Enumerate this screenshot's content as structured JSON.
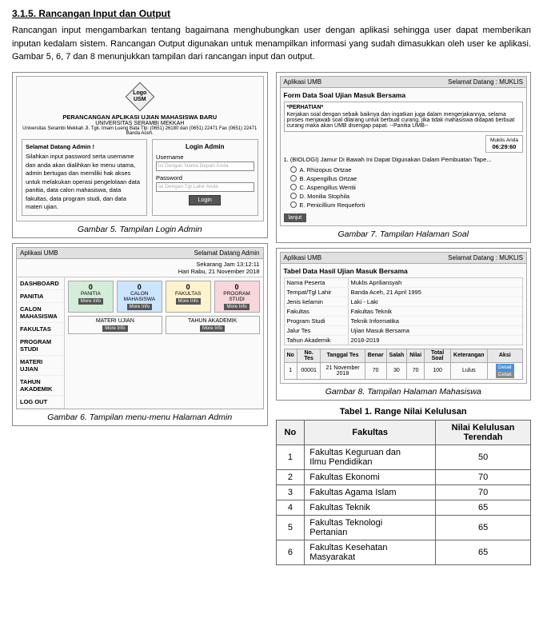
{
  "section": {
    "title": "3.1.5. Rancangan Input dan Output",
    "intro": "Rancangan input mengambarkan tentang bagaimana menghubungkan user dengan aplikasi sehingga user dapat memberikan inputan kedalam sistem. Rancangan Output digunakan untuk menampilkan informasi yang sudah dimasukkan oleh user ke aplikasi. Gambar 5, 6, 7 dan 8 menunjukkan tampilan dari rancangan input dan output."
  },
  "fig5": {
    "caption": "Gambar 5. Tampilan Login Admin",
    "logo": {
      "line1": "Logo",
      "line2": "USM"
    },
    "app_title": "PERANCANGAN APLIKASI UJIAN MAHASISWA BARU",
    "app_subtitle": "UNIVERSITAS SERAMBI MEKKAH",
    "app_address": "Universitas Serambi Mekkah Jl. Tgk. Imam Lueng Bata Tlp: (0651) 26180 dan (0651) 22471 Fax (0651) 22471 Banda Aceh.",
    "left_panel_title": "Selamat Datang Admin !",
    "left_panel_text": "Silahkan input password serta username dan anda akan dialihkan ke menu utama, admin bertugas dan memiliki hak akses untuk melakukan operasi pengelolaan data panitia, data calon mahasiswa, data fakultas, data program studi, dan data materi ujian.",
    "right_panel_title": "Login Admin",
    "username_label": "Username",
    "username_placeholder": "isi Dengan Nama Depan Anda",
    "password_label": "Password",
    "password_placeholder": "Isi Dengan Tgl Lahir Anda",
    "login_btn": "Login"
  },
  "fig6": {
    "caption": "Gambar 6. Tampilan menu-menu Halaman Admin",
    "app_name": "Aplikasi UMB",
    "welcome": "Selamat Datang Admin",
    "datetime": "Sekarang Jam 13:12:11",
    "date_label": "Hari Rabu, 21 November 2018",
    "sidebar_items": [
      "DASHBOARD",
      "PANITIA",
      "CALON MAHASISWA",
      "FAKULTAS",
      "PROGRAM STUDI",
      "MATERI UJIAN",
      "TAHUN AKADEMIK",
      "LOG OUT"
    ],
    "cards": [
      {
        "num": "0",
        "label": "PANITIA",
        "btn": "More Info"
      },
      {
        "num": "0",
        "label": "CALON MAHASISWA",
        "btn": "More Info"
      },
      {
        "num": "0",
        "label": "FAKULTAS",
        "btn": "More Info"
      },
      {
        "num": "0",
        "label": "PROGRAM STUDI",
        "btn": "More Info"
      }
    ],
    "cards2": [
      {
        "label": "MATERI UJIAN",
        "btn": "More Info"
      },
      {
        "label": "TAHUN AKADEMIK",
        "btn": "More Info"
      }
    ]
  },
  "fig7": {
    "caption": "Gambar 7. Tampilan Halaman Soal",
    "app_name": "Aplikasi UMB",
    "welcome": "Selamat Datang : MUKLIS",
    "form_title": "Form Data Soal Ujian Masuk Bersama",
    "notice_title": "*PERHATIAN*",
    "notice_text": "Kerjakan soal dengan sebaik baiknya dan ingatkan juga dalam mengerjakannya, selama proses menjawab soal dilarang untuk berbuat curang, jika tidak mahasiswa didapati berbuat curang maka akan UMB disengap papat. --Panitia UMB--",
    "student_name": "Muklis Anda",
    "timer": "06:29:60",
    "question_num": "1. (BIOLOGI) Jamur Di Bawah Ini Dapat Digunakan Dalam Pembuatan Tape...",
    "options": [
      "A. Rhizopus Ortzae",
      "B. Aspengillus Ortzae",
      "C. Aspengillus Wentii",
      "D. Monilia Stophila",
      "E. Penicillium Requeforti"
    ],
    "next_btn": "lanjut"
  },
  "fig8": {
    "caption": "Gambar 8. Tampilan Halaman Mahasiswa",
    "app_name": "Aplikasi UMB",
    "welcome": "Selamat Datang : MUKLIS",
    "table_title": "Tabel Data Hasil Ujian Masuk Bersama",
    "fields": [
      {
        "label": "Nama Peserta",
        "value": "Muklis Apriliansyah"
      },
      {
        "label": "Tempat/Tgl Lahir",
        "value": "Banda Aceh, 21 April 1995"
      },
      {
        "label": "Jenis kelamin",
        "value": "Laki - Laki"
      },
      {
        "label": "Fakultas",
        "value": "Fakultas Teknik"
      },
      {
        "label": "Program Studi",
        "value": "Teknik Informatika"
      },
      {
        "label": "Jalur Tes",
        "value": "Ujian Masuk Bersama"
      },
      {
        "label": "Tahun Akademik",
        "value": "2018-2019"
      }
    ],
    "result_headers": [
      "No",
      "No. Tes",
      "Tanggal Tes",
      "Benar",
      "Salah",
      "Nilai",
      "Total Soal",
      "Keterangan",
      "Aksi"
    ],
    "result_row": {
      "no": "1",
      "no_tes": "00001",
      "tanggal": "21 November 2018",
      "benar": "70",
      "salah": "30",
      "nilai": "70",
      "total": "100",
      "keterangan": "Lulus",
      "btn_detail": "Detail",
      "btn_print": "Cetak"
    }
  },
  "table1": {
    "title": "Tabel 1. Range Nilai Kelulusan",
    "headers": [
      "No",
      "Fakultas",
      "Nilai Kelulusan\nTerendah"
    ],
    "header_no": "No",
    "header_fakultas": "Fakultas",
    "header_nilai": "Nilai Kelulusan Terendah",
    "rows": [
      {
        "no": "1",
        "fakultas": "Fakultas Keguruan dan Ilmu Pendidikan",
        "nilai": "50"
      },
      {
        "no": "2",
        "fakultas": "Fakultas Ekonomi",
        "nilai": "70"
      },
      {
        "no": "3",
        "fakultas": "Fakultas Agama Islam",
        "nilai": "70"
      },
      {
        "no": "4",
        "fakultas": "Fakultas Teknik",
        "nilai": "65"
      },
      {
        "no": "5",
        "fakultas": "Fakultas Teknologi Pertanian",
        "nilai": "65"
      },
      {
        "no": "6",
        "fakultas": "Fakultas Kesehatan Masyarakat",
        "nilai": "65"
      }
    ]
  }
}
